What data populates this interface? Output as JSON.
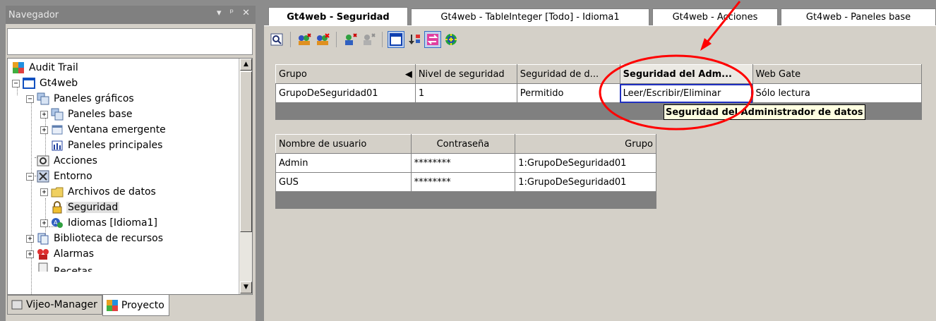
{
  "navigator": {
    "title": "Navegador",
    "tree": [
      {
        "label": "Audit Trail",
        "icon": "audit-trail-icon"
      },
      {
        "label": "Gt4web",
        "icon": "project-window-icon"
      },
      {
        "label": "Paneles gráficos",
        "icon": "panels-icon"
      },
      {
        "label": "Paneles base",
        "icon": "panels-icon"
      },
      {
        "label": "Ventana emergente",
        "icon": "popup-window-icon"
      },
      {
        "label": "Paneles principales",
        "icon": "main-panels-icon"
      },
      {
        "label": "Acciones",
        "icon": "actions-icon"
      },
      {
        "label": "Entorno",
        "icon": "tools-icon"
      },
      {
        "label": "Archivos de datos",
        "icon": "folder-icon"
      },
      {
        "label": "Seguridad",
        "icon": "security-lock-icon"
      },
      {
        "label": "Idiomas [Idioma1]",
        "icon": "languages-icon"
      },
      {
        "label": "Biblioteca de recursos",
        "icon": "library-icon"
      },
      {
        "label": "Alarmas",
        "icon": "alarm-icon"
      },
      {
        "label": "Recetas",
        "icon": "recipes-icon"
      }
    ],
    "bottom_tabs": [
      "Vijeo-Manager",
      "Proyecto"
    ],
    "active_bottom_tab": "Proyecto"
  },
  "doc_tabs": [
    "Gt4web - Seguridad",
    "Gt4web - TableInteger [Todo] - Idioma1",
    "Gt4web - Acciones",
    "Gt4web - Paneles base"
  ],
  "active_doc_tab": "Gt4web - Seguridad",
  "groups_table": {
    "headers": [
      "Grupo",
      "Nivel de seguridad",
      "Seguridad de d...",
      "Seguridad del Adm...",
      "Web Gate"
    ],
    "rows": [
      [
        "GrupoDeSeguridad01",
        "1",
        "Permitido",
        "Leer/Escribir/Eliminar",
        "Sólo lectura"
      ]
    ]
  },
  "tooltip": "Seguridad del Administrador de datos",
  "users_table": {
    "headers": [
      "Nombre de usuario",
      "Contraseña",
      "Grupo"
    ],
    "rows": [
      [
        "Admin",
        "********",
        "1:GrupoDeSeguridad01"
      ],
      [
        "GUS",
        "********",
        "1:GrupoDeSeguridad01"
      ]
    ]
  },
  "colors": {
    "annotation": "#ff0000",
    "focus": "#2030c0",
    "tooltip_bg": "#ffffe1"
  }
}
